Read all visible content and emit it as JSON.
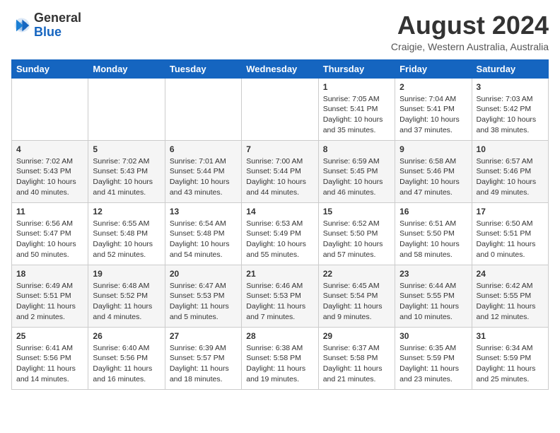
{
  "logo": {
    "general": "General",
    "blue": "Blue"
  },
  "title": "August 2024",
  "location": "Craigie, Western Australia, Australia",
  "days_of_week": [
    "Sunday",
    "Monday",
    "Tuesday",
    "Wednesday",
    "Thursday",
    "Friday",
    "Saturday"
  ],
  "weeks": [
    [
      {
        "day": "",
        "info": ""
      },
      {
        "day": "",
        "info": ""
      },
      {
        "day": "",
        "info": ""
      },
      {
        "day": "",
        "info": ""
      },
      {
        "day": "1",
        "info": "Sunrise: 7:05 AM\nSunset: 5:41 PM\nDaylight: 10 hours\nand 35 minutes."
      },
      {
        "day": "2",
        "info": "Sunrise: 7:04 AM\nSunset: 5:41 PM\nDaylight: 10 hours\nand 37 minutes."
      },
      {
        "day": "3",
        "info": "Sunrise: 7:03 AM\nSunset: 5:42 PM\nDaylight: 10 hours\nand 38 minutes."
      }
    ],
    [
      {
        "day": "4",
        "info": "Sunrise: 7:02 AM\nSunset: 5:43 PM\nDaylight: 10 hours\nand 40 minutes."
      },
      {
        "day": "5",
        "info": "Sunrise: 7:02 AM\nSunset: 5:43 PM\nDaylight: 10 hours\nand 41 minutes."
      },
      {
        "day": "6",
        "info": "Sunrise: 7:01 AM\nSunset: 5:44 PM\nDaylight: 10 hours\nand 43 minutes."
      },
      {
        "day": "7",
        "info": "Sunrise: 7:00 AM\nSunset: 5:44 PM\nDaylight: 10 hours\nand 44 minutes."
      },
      {
        "day": "8",
        "info": "Sunrise: 6:59 AM\nSunset: 5:45 PM\nDaylight: 10 hours\nand 46 minutes."
      },
      {
        "day": "9",
        "info": "Sunrise: 6:58 AM\nSunset: 5:46 PM\nDaylight: 10 hours\nand 47 minutes."
      },
      {
        "day": "10",
        "info": "Sunrise: 6:57 AM\nSunset: 5:46 PM\nDaylight: 10 hours\nand 49 minutes."
      }
    ],
    [
      {
        "day": "11",
        "info": "Sunrise: 6:56 AM\nSunset: 5:47 PM\nDaylight: 10 hours\nand 50 minutes."
      },
      {
        "day": "12",
        "info": "Sunrise: 6:55 AM\nSunset: 5:48 PM\nDaylight: 10 hours\nand 52 minutes."
      },
      {
        "day": "13",
        "info": "Sunrise: 6:54 AM\nSunset: 5:48 PM\nDaylight: 10 hours\nand 54 minutes."
      },
      {
        "day": "14",
        "info": "Sunrise: 6:53 AM\nSunset: 5:49 PM\nDaylight: 10 hours\nand 55 minutes."
      },
      {
        "day": "15",
        "info": "Sunrise: 6:52 AM\nSunset: 5:50 PM\nDaylight: 10 hours\nand 57 minutes."
      },
      {
        "day": "16",
        "info": "Sunrise: 6:51 AM\nSunset: 5:50 PM\nDaylight: 10 hours\nand 58 minutes."
      },
      {
        "day": "17",
        "info": "Sunrise: 6:50 AM\nSunset: 5:51 PM\nDaylight: 11 hours\nand 0 minutes."
      }
    ],
    [
      {
        "day": "18",
        "info": "Sunrise: 6:49 AM\nSunset: 5:51 PM\nDaylight: 11 hours\nand 2 minutes."
      },
      {
        "day": "19",
        "info": "Sunrise: 6:48 AM\nSunset: 5:52 PM\nDaylight: 11 hours\nand 4 minutes."
      },
      {
        "day": "20",
        "info": "Sunrise: 6:47 AM\nSunset: 5:53 PM\nDaylight: 11 hours\nand 5 minutes."
      },
      {
        "day": "21",
        "info": "Sunrise: 6:46 AM\nSunset: 5:53 PM\nDaylight: 11 hours\nand 7 minutes."
      },
      {
        "day": "22",
        "info": "Sunrise: 6:45 AM\nSunset: 5:54 PM\nDaylight: 11 hours\nand 9 minutes."
      },
      {
        "day": "23",
        "info": "Sunrise: 6:44 AM\nSunset: 5:55 PM\nDaylight: 11 hours\nand 10 minutes."
      },
      {
        "day": "24",
        "info": "Sunrise: 6:42 AM\nSunset: 5:55 PM\nDaylight: 11 hours\nand 12 minutes."
      }
    ],
    [
      {
        "day": "25",
        "info": "Sunrise: 6:41 AM\nSunset: 5:56 PM\nDaylight: 11 hours\nand 14 minutes."
      },
      {
        "day": "26",
        "info": "Sunrise: 6:40 AM\nSunset: 5:56 PM\nDaylight: 11 hours\nand 16 minutes."
      },
      {
        "day": "27",
        "info": "Sunrise: 6:39 AM\nSunset: 5:57 PM\nDaylight: 11 hours\nand 18 minutes."
      },
      {
        "day": "28",
        "info": "Sunrise: 6:38 AM\nSunset: 5:58 PM\nDaylight: 11 hours\nand 19 minutes."
      },
      {
        "day": "29",
        "info": "Sunrise: 6:37 AM\nSunset: 5:58 PM\nDaylight: 11 hours\nand 21 minutes."
      },
      {
        "day": "30",
        "info": "Sunrise: 6:35 AM\nSunset: 5:59 PM\nDaylight: 11 hours\nand 23 minutes."
      },
      {
        "day": "31",
        "info": "Sunrise: 6:34 AM\nSunset: 5:59 PM\nDaylight: 11 hours\nand 25 minutes."
      }
    ]
  ]
}
